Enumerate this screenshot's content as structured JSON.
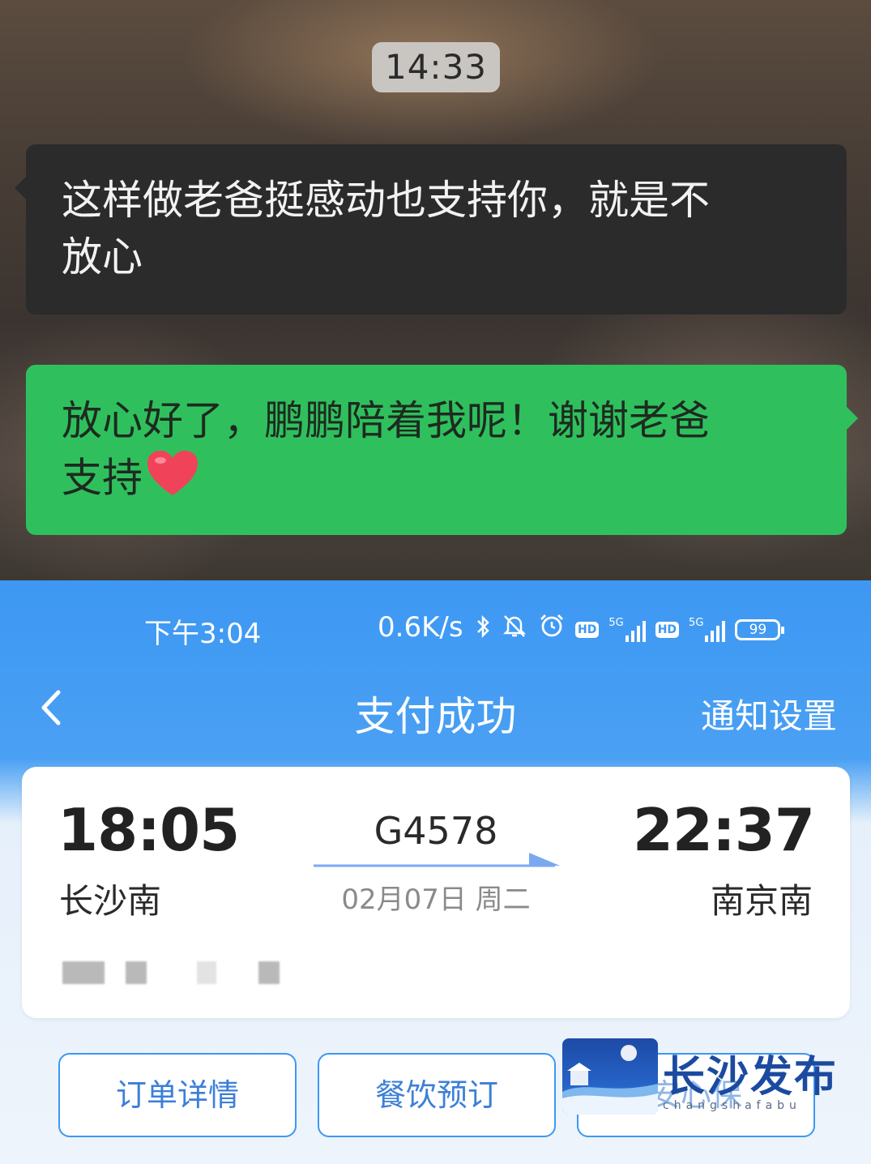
{
  "chat": {
    "timestamp": "14:33",
    "messages": [
      {
        "side": "left",
        "text_line1": "这样做老爸挺感动也支持你，就是不",
        "text_line2": "放心"
      },
      {
        "side": "right",
        "text_line1": "放心好了，鹏鹏陪着我呢！谢谢老爸",
        "text_line2": "支持",
        "emoji": "heart-emoji"
      }
    ]
  },
  "status_bar": {
    "time": "下午3:04",
    "net_speed": "0.6K/s",
    "hd1": "HD",
    "hd2": "HD",
    "net1": "5G",
    "net2": "5G",
    "battery": "99"
  },
  "navbar": {
    "title": "支付成功",
    "right_label": "通知设置"
  },
  "ticket": {
    "depart_time": "18:05",
    "depart_station": "长沙南",
    "train_number": "G4578",
    "date": "02月07日 周二",
    "arrive_time": "22:37",
    "arrive_station": "南京南"
  },
  "actions": {
    "order_details": "订单详情",
    "dining_booking": "餐饮预订",
    "insurance": "安心保"
  },
  "watermark": {
    "title": "长沙发布",
    "subtitle": "changshafabu"
  },
  "colors": {
    "accent": "#3d98f3",
    "chat_sent": "#2fc05d",
    "chat_received": "#2c2b2b"
  }
}
